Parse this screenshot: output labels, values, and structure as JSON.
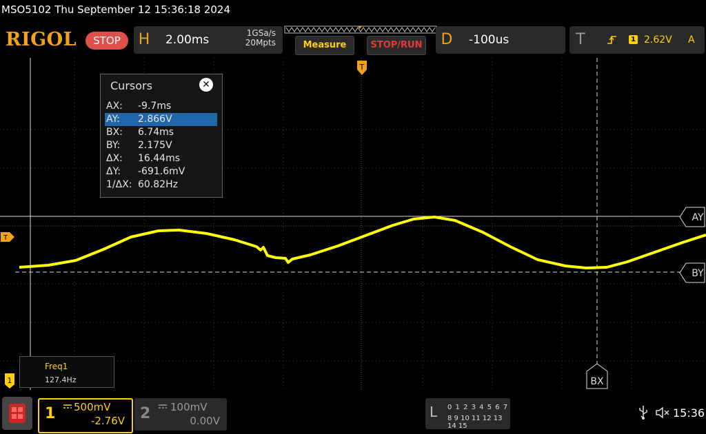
{
  "title": "MSO5102  Thu September 12 15:36:18 2024",
  "brand": "RIGOL",
  "run_state": "STOP",
  "horizontal": {
    "letter": "H",
    "timebase": "2.00ms",
    "sample_rate": "1GSa/s",
    "memory_depth": "20Mpts"
  },
  "buttons": {
    "measure": "Measure",
    "stop_run": "STOP/RUN"
  },
  "delay": {
    "letter": "D",
    "value": "-100us"
  },
  "trigger": {
    "letter": "T",
    "source": "1",
    "level": "2.62V",
    "mode": "A"
  },
  "cursors": {
    "title": "Cursors",
    "rows": [
      {
        "key": "AX:",
        "value": "-9.7ms"
      },
      {
        "key": "AY:",
        "value": "2.866V"
      },
      {
        "key": "BX:",
        "value": "6.74ms"
      },
      {
        "key": "BY:",
        "value": "2.175V"
      },
      {
        "key": "ΔX:",
        "value": "16.44ms"
      },
      {
        "key": "ΔY:",
        "value": "-691.6mV"
      },
      {
        "key": "1/ΔX:",
        "value": "60.82Hz"
      }
    ],
    "selected_row": 1
  },
  "cursor_tags": {
    "ay": "AY",
    "by": "BY",
    "bx": "BX",
    "trig_marker": "T",
    "trig_level_marker": "T",
    "ch1_marker": "1"
  },
  "measurement": {
    "name": "Freq1",
    "value": "127.4Hz"
  },
  "channels": {
    "ch1": {
      "number": "1",
      "scale": "500mV",
      "offset": "-2.76V",
      "color": "#ffd000"
    },
    "ch2": {
      "number": "2",
      "scale": "100mV",
      "offset": "0.00V",
      "color": "#888888"
    }
  },
  "logic": {
    "letter": "L",
    "row1": "0 1 2 3  4 5 6 7",
    "row2": "8 9 10 11 12 13 14 15"
  },
  "clock": "15:36",
  "colors": {
    "trace": "#ffff00",
    "accent": "#f0a21a",
    "stop": "#e0504b",
    "grid": "#3a3a3a"
  }
}
